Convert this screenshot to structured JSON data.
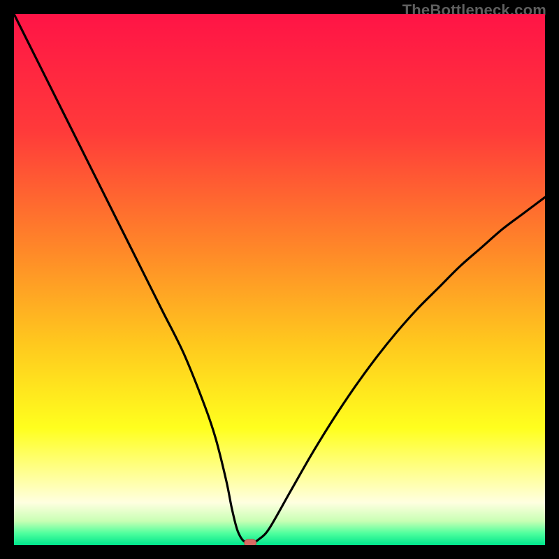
{
  "watermark": "TheBottleneck.com",
  "colors": {
    "frame": "#000000",
    "curve": "#000000",
    "marker_fill": "#d96a63",
    "marker_stroke": "#b6564f",
    "gradient_stops": [
      {
        "offset": 0.0,
        "color": "#ff1446"
      },
      {
        "offset": 0.22,
        "color": "#ff3a3a"
      },
      {
        "offset": 0.45,
        "color": "#ff8a28"
      },
      {
        "offset": 0.62,
        "color": "#ffc81e"
      },
      {
        "offset": 0.78,
        "color": "#ffff1e"
      },
      {
        "offset": 0.88,
        "color": "#ffffa8"
      },
      {
        "offset": 0.92,
        "color": "#ffffe0"
      },
      {
        "offset": 0.955,
        "color": "#c8ffb4"
      },
      {
        "offset": 0.978,
        "color": "#4fff9e"
      },
      {
        "offset": 1.0,
        "color": "#00e58c"
      }
    ]
  },
  "chart_data": {
    "type": "line",
    "title": "",
    "xlabel": "",
    "ylabel": "",
    "xlim": [
      0,
      100
    ],
    "ylim": [
      0,
      100
    ],
    "x": [
      0,
      4,
      8,
      12,
      16,
      20,
      24,
      28,
      32,
      36,
      38,
      40,
      41,
      42,
      43,
      44,
      45,
      46,
      48,
      52,
      56,
      60,
      64,
      68,
      72,
      76,
      80,
      84,
      88,
      92,
      96,
      100
    ],
    "values": [
      100,
      92,
      84,
      76,
      68,
      60,
      52,
      44,
      36,
      26,
      20,
      12,
      7,
      3,
      1,
      0.4,
      0.4,
      1,
      3,
      10,
      17,
      23.5,
      29.5,
      35,
      40,
      44.5,
      48.5,
      52.5,
      56,
      59.5,
      62.5,
      65.5
    ],
    "marker": {
      "x": 44.5,
      "y": 0.4
    },
    "flat_min_range": [
      43,
      45.5
    ]
  }
}
